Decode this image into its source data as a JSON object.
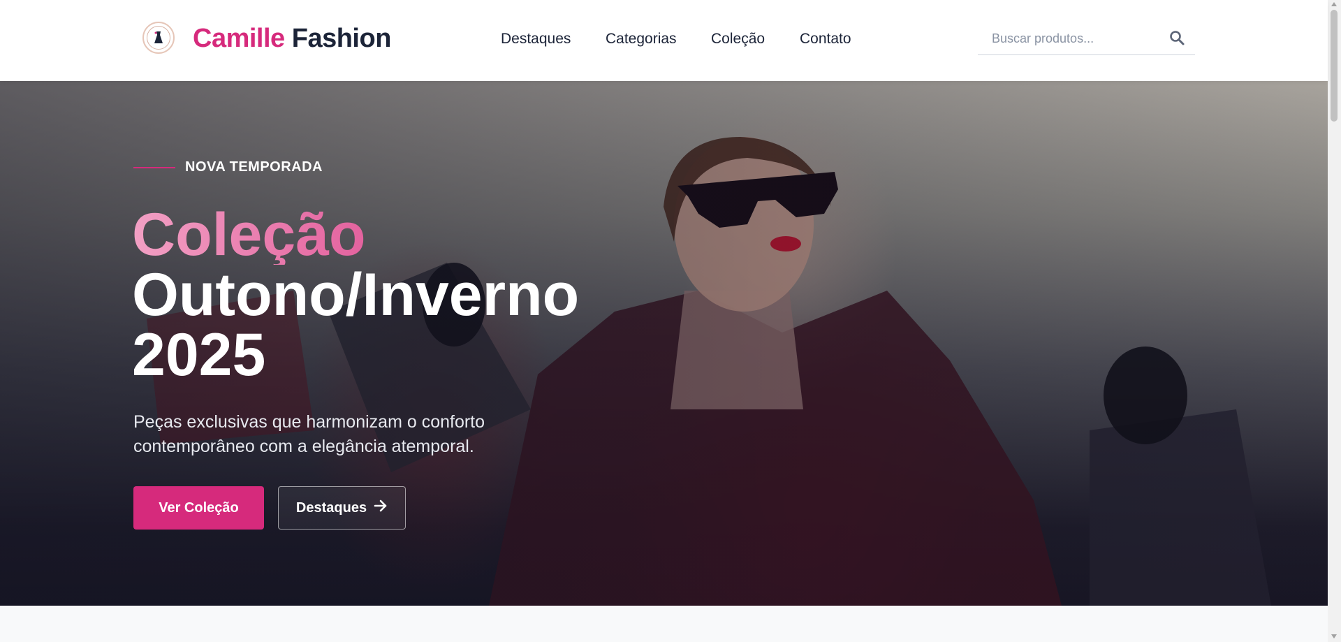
{
  "header": {
    "brand_first": "Camille",
    "brand_second": "Fashion",
    "nav": [
      {
        "label": "Destaques"
      },
      {
        "label": "Categorias"
      },
      {
        "label": "Coleção"
      },
      {
        "label": "Contato"
      }
    ],
    "search": {
      "placeholder": "Buscar produtos...",
      "value": "",
      "icon": "search-icon"
    }
  },
  "hero": {
    "tag": "NOVA TEMPORADA",
    "title_line1": "Coleção",
    "title_line2": "Outono/Inverno",
    "title_line3": "2025",
    "subtitle": "Peças exclusivas que harmonizam o conforto contemporâneo com a elegância atemporal.",
    "primary_button": "Ver Coleção",
    "secondary_button": "Destaques",
    "secondary_icon": "arrow-right-icon"
  },
  "colors": {
    "accent": "#d62a7c",
    "dark": "#1c2438",
    "light_accent": "#f2a0c4"
  }
}
